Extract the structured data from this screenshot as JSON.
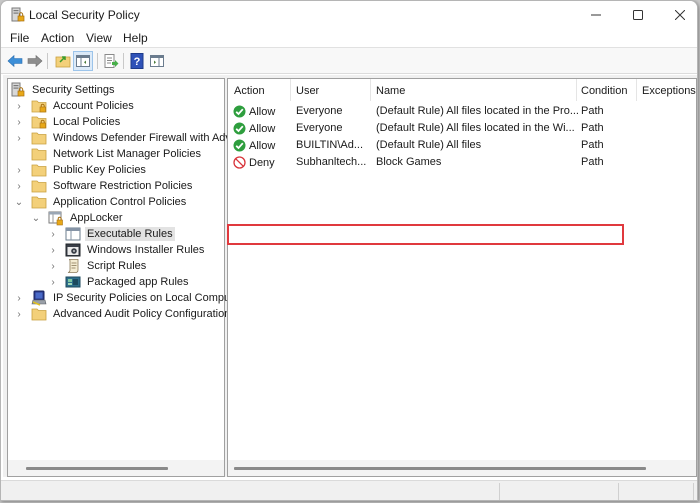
{
  "window": {
    "title": "Local Security Policy",
    "title_icon": "security-policy-icon",
    "controls": [
      "minimize",
      "maximize",
      "close"
    ]
  },
  "menubar": {
    "items": [
      {
        "label": "File"
      },
      {
        "label": "Action"
      },
      {
        "label": "View"
      },
      {
        "label": "Help"
      }
    ]
  },
  "toolbar": {
    "buttons": [
      {
        "icon": "back-arrow-icon"
      },
      {
        "icon": "forward-arrow-icon"
      },
      {
        "icon": "up-folder-icon"
      },
      {
        "icon": "show-hide-console-tree-icon",
        "active": true
      },
      {
        "icon": "export-list-icon"
      },
      {
        "icon": "help-icon"
      },
      {
        "icon": "show-hide-action-pane-icon"
      }
    ]
  },
  "tree": {
    "root": "Security Settings",
    "items": [
      {
        "label": "Account Policies",
        "expander": "collapsed",
        "level": 1,
        "icon": "locked-folder-icon"
      },
      {
        "label": "Local Policies",
        "expander": "collapsed",
        "level": 1,
        "icon": "locked-folder-icon"
      },
      {
        "label": "Windows Defender Firewall with Adva",
        "expander": "collapsed",
        "level": 1,
        "icon": "folder-icon"
      },
      {
        "label": "Network List Manager Policies",
        "expander": "none",
        "level": 1,
        "icon": "folder-icon"
      },
      {
        "label": "Public Key Policies",
        "expander": "collapsed",
        "level": 1,
        "icon": "folder-icon"
      },
      {
        "label": "Software Restriction Policies",
        "expander": "collapsed",
        "level": 1,
        "icon": "folder-icon"
      },
      {
        "label": "Application Control Policies",
        "expander": "expanded",
        "level": 1,
        "icon": "folder-icon"
      },
      {
        "label": "AppLocker",
        "expander": "expanded",
        "level": 2,
        "icon": "applocker-icon"
      },
      {
        "label": "Executable Rules",
        "expander": "collapsed",
        "level": 3,
        "icon": "window-rules-icon",
        "selected": true
      },
      {
        "label": "Windows Installer Rules",
        "expander": "collapsed",
        "level": 3,
        "icon": "installer-icon"
      },
      {
        "label": "Script Rules",
        "expander": "collapsed",
        "level": 3,
        "icon": "script-icon"
      },
      {
        "label": "Packaged app Rules",
        "expander": "collapsed",
        "level": 3,
        "icon": "packaged-app-icon"
      },
      {
        "label": "IP Security Policies on Local Compute",
        "expander": "collapsed",
        "level": 1,
        "icon": "ip-security-icon"
      },
      {
        "label": "Advanced Audit Policy Configuration",
        "expander": "collapsed",
        "level": 1,
        "icon": "folder-icon"
      }
    ]
  },
  "list": {
    "columns": [
      "Action",
      "User",
      "Name",
      "Condition",
      "Exceptions"
    ],
    "rows": [
      {
        "action": "Allow",
        "action_icon": "allow-check-icon",
        "user": "Everyone",
        "name": "(Default Rule) All files located in the Pro...",
        "condition": "Path",
        "exceptions": ""
      },
      {
        "action": "Allow",
        "action_icon": "allow-check-icon",
        "user": "Everyone",
        "name": "(Default Rule) All files located in the Wi...",
        "condition": "Path",
        "exceptions": ""
      },
      {
        "action": "Allow",
        "action_icon": "allow-check-icon",
        "user": "BUILTIN\\Ad...",
        "name": "(Default Rule) All files",
        "condition": "Path",
        "exceptions": ""
      },
      {
        "action": "Deny",
        "action_icon": "deny-icon",
        "user": "Subhanltech...",
        "name": "Block Games",
        "condition": "Path",
        "exceptions": "",
        "highlighted": true
      }
    ]
  },
  "colors": {
    "highlight_border": "#e0393e",
    "allow_green": "#2e9e3e",
    "deny_red": "#d8343a",
    "folder_yellow": "#f3d07a"
  }
}
